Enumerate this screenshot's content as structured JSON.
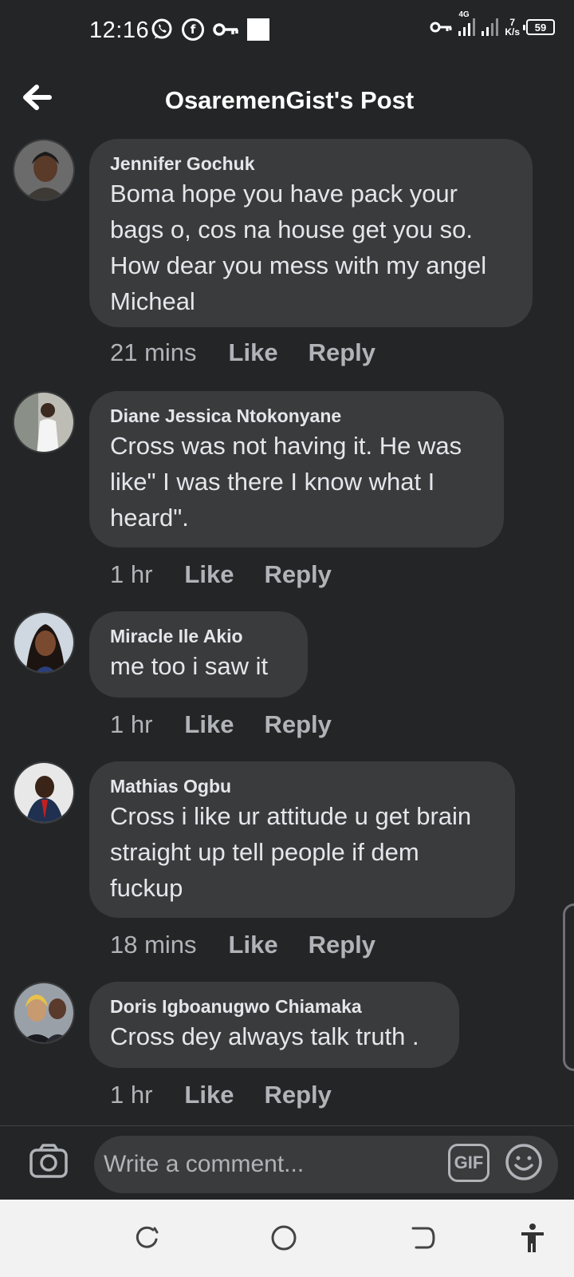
{
  "status_bar": {
    "time": "12:16",
    "network_type": "4G",
    "speed_value": "7",
    "speed_unit": "K/s",
    "battery": "59"
  },
  "header": {
    "title": "OsaremenGist's Post"
  },
  "comments": [
    {
      "author": "Jennifer Gochuk",
      "text": "Boma hope you have pack your bags o, cos na house get you so. How dear you mess with my angel Micheal",
      "time": "21 mins",
      "like": "Like",
      "reply": "Reply"
    },
    {
      "author": "Diane Jessica Ntokonyane",
      "text": "Cross was not having it. He was like\" I was there I know what I heard\".",
      "time": "1 hr",
      "like": "Like",
      "reply": "Reply"
    },
    {
      "author": "Miracle Ile Akio",
      "text": "me too i saw it",
      "time": "1 hr",
      "like": "Like",
      "reply": "Reply"
    },
    {
      "author": "Mathias Ogbu",
      "text": "Cross i like ur attitude u get brain straight up tell people if dem fuckup",
      "time": "18 mins",
      "like": "Like",
      "reply": "Reply"
    },
    {
      "author": "Doris Igboanugwo Chiamaka",
      "text": "Cross dey always talk truth .",
      "time": "1 hr",
      "like": "Like",
      "reply": "Reply"
    }
  ],
  "composer": {
    "placeholder": "Write a comment...",
    "gif_label": "GIF"
  },
  "icons": {
    "back": "arrow-left-icon",
    "camera": "camera-icon",
    "emoji": "smiley-icon",
    "nav_recents": "recents-icon",
    "nav_home": "home-icon",
    "nav_back": "back-icon",
    "accessibility": "accessibility-icon"
  },
  "colors": {
    "background": "#242526",
    "bubble": "#3a3b3c",
    "text_primary": "#e4e6eb",
    "text_secondary": "#b0b3b8",
    "nav_bar": "#f2f2f2"
  }
}
